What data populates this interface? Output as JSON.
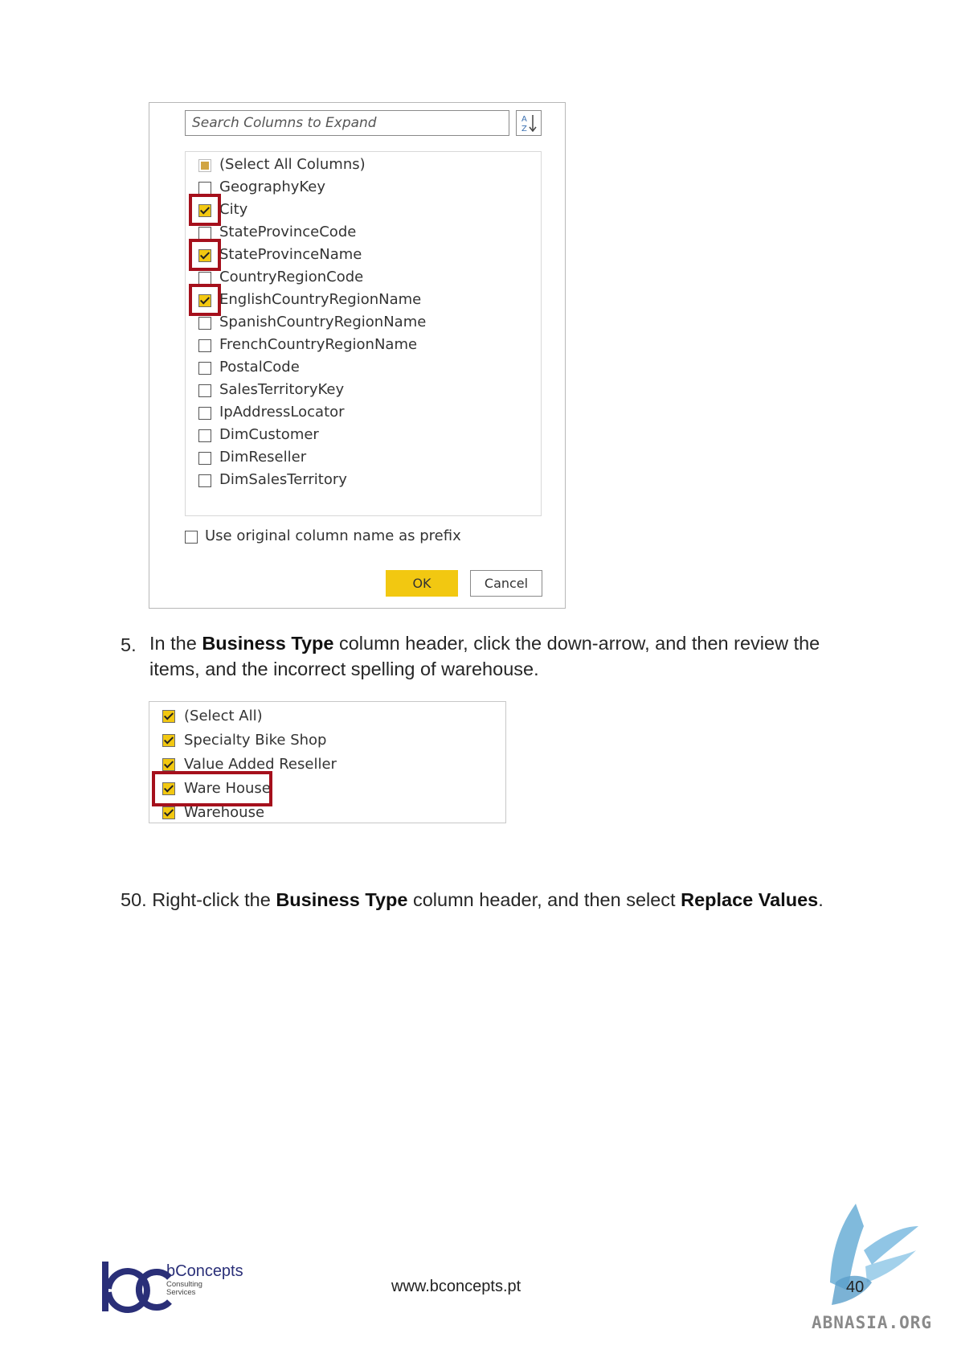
{
  "expand_dialog": {
    "search_placeholder": "Search Columns to Expand",
    "sort_icon": "sort-az-icon",
    "columns": [
      {
        "label": "(Select All Columns)",
        "state": "partial"
      },
      {
        "label": "GeographyKey",
        "state": "unchecked"
      },
      {
        "label": "City",
        "state": "checked"
      },
      {
        "label": "StateProvinceCode",
        "state": "unchecked"
      },
      {
        "label": "StateProvinceName",
        "state": "checked"
      },
      {
        "label": "CountryRegionCode",
        "state": "unchecked"
      },
      {
        "label": "EnglishCountryRegionName",
        "state": "checked"
      },
      {
        "label": "SpanishCountryRegionName",
        "state": "unchecked"
      },
      {
        "label": "FrenchCountryRegionName",
        "state": "unchecked"
      },
      {
        "label": "PostalCode",
        "state": "unchecked"
      },
      {
        "label": "SalesTerritoryKey",
        "state": "unchecked"
      },
      {
        "label": "IpAddressLocator",
        "state": "unchecked"
      },
      {
        "label": "DimCustomer",
        "state": "unchecked"
      },
      {
        "label": "DimReseller",
        "state": "unchecked"
      },
      {
        "label": "DimSalesTerritory",
        "state": "unchecked"
      }
    ],
    "prefix_label": "Use original column name as prefix",
    "ok_label": "OK",
    "cancel_label": "Cancel"
  },
  "step5": {
    "number": "5.",
    "line1_pre": "In the ",
    "line1_bold": "Business Type",
    "line1_post": " column header, click the down-arrow, and then review the",
    "line2": "items, and the incorrect spelling of warehouse."
  },
  "filter_list": {
    "items": [
      {
        "label": "(Select All)",
        "state": "checked"
      },
      {
        "label": "Specialty Bike Shop",
        "state": "checked"
      },
      {
        "label": "Value Added Reseller",
        "state": "checked"
      },
      {
        "label": "Ware House",
        "state": "checked"
      },
      {
        "label": "Warehouse",
        "state": "checked"
      }
    ]
  },
  "step50": {
    "number": "50.",
    "pre": "Right-click the ",
    "bold1": "Business Type",
    "mid": " column header, and then select ",
    "bold2": "Replace Values",
    "post": "."
  },
  "footer": {
    "brand_name": "bConcepts",
    "brand_sub1": "Consulting",
    "brand_sub2": "Services",
    "url": "www.bconcepts.pt",
    "page_number": "40",
    "watermark": "ABNASIA.ORG"
  },
  "colors": {
    "accent_yellow": "#f2c811",
    "highlight_red": "#a5101c",
    "brand_blue": "#2a2f78"
  }
}
